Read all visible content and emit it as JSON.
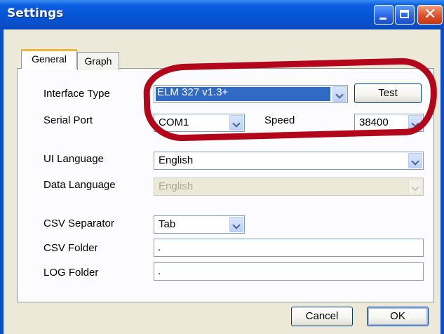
{
  "window": {
    "title": "Settings"
  },
  "tabs": [
    {
      "label": "General",
      "active": true
    },
    {
      "label": "Graph",
      "active": false
    }
  ],
  "form": {
    "interface_type": {
      "label": "Interface Type",
      "value": "ELM 327 v1.3+"
    },
    "test_button": "Test",
    "serial_port": {
      "label": "Serial Port",
      "value": "COM1"
    },
    "speed": {
      "label": "Speed",
      "value": "38400"
    },
    "ui_language": {
      "label": "UI Language",
      "value": "English"
    },
    "data_language": {
      "label": "Data Language",
      "value": "English",
      "disabled": true
    },
    "csv_separator": {
      "label": "CSV Separator",
      "value": "Tab"
    },
    "csv_folder": {
      "label": "CSV Folder",
      "value": "."
    },
    "log_folder": {
      "label": "LOG Folder",
      "value": "."
    }
  },
  "footer": {
    "cancel": "Cancel",
    "ok": "OK"
  },
  "colors": {
    "titlebar": "#0a4fc8",
    "annotation": "#b3061a",
    "selection": "#316ac5"
  }
}
